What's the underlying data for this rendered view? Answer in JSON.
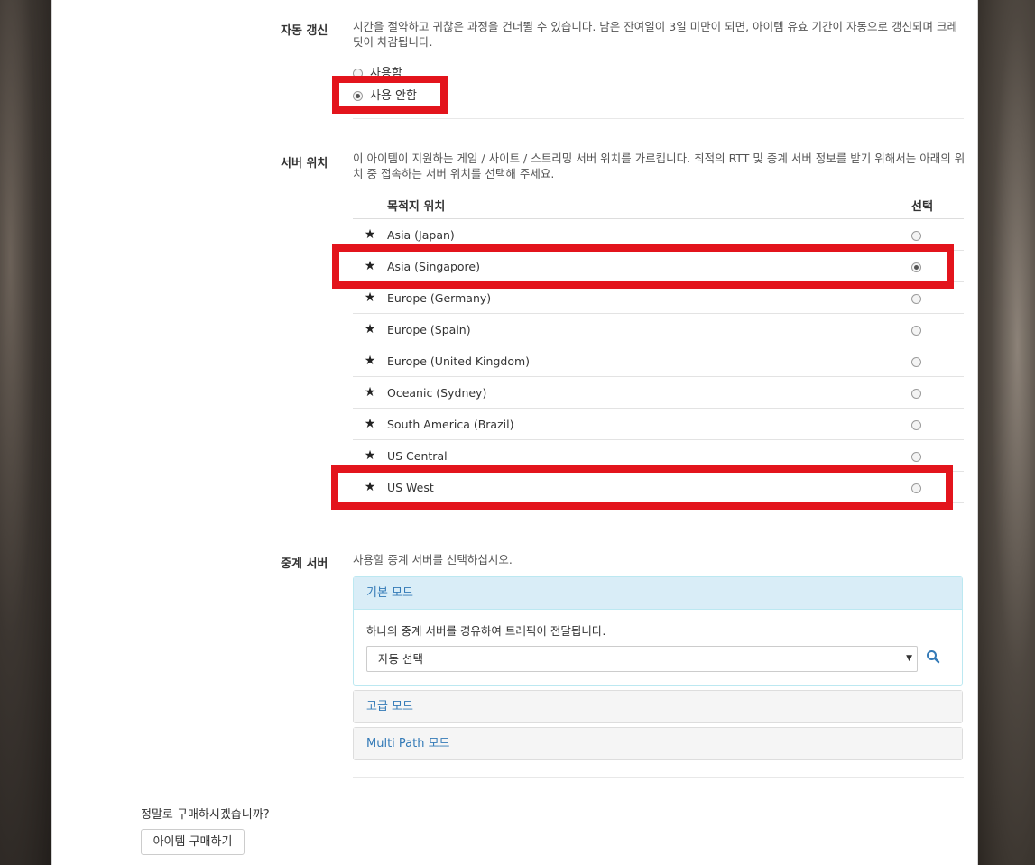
{
  "auto_renew": {
    "label": "자동 갱신",
    "description": "시간을 절약하고 귀찮은 과정을 건너뛸 수 있습니다. 남은 잔여일이 3일 미만이 되면, 아이템 유효 기간이 자동으로 갱신되며 크레딧이 차감됩니다.",
    "options": [
      {
        "label": "사용함",
        "checked": false
      },
      {
        "label": "사용 안함",
        "checked": true
      }
    ]
  },
  "server_location": {
    "label": "서버 위치",
    "description": "이 아이템이 지원하는 게임 / 사이트 / 스트리밍 서버 위치를 가르킵니다. 최적의 RTT 및 중계 서버 정보를 받기 위해서는 아래의 위치 중 접속하는 서버 위치를 선택해 주세요.",
    "col_destination": "목적지 위치",
    "col_select": "선택",
    "rows": [
      {
        "name": "Asia (Japan)",
        "selected": false
      },
      {
        "name": "Asia (Singapore)",
        "selected": true
      },
      {
        "name": "Europe (Germany)",
        "selected": false
      },
      {
        "name": "Europe (Spain)",
        "selected": false
      },
      {
        "name": "Europe (United Kingdom)",
        "selected": false
      },
      {
        "name": "Oceanic (Sydney)",
        "selected": false
      },
      {
        "name": "South America (Brazil)",
        "selected": false
      },
      {
        "name": "US Central",
        "selected": false
      },
      {
        "name": "US West",
        "selected": false
      }
    ]
  },
  "relay_server": {
    "label": "중계 서버",
    "description": "사용할 중계 서버를 선택하십시오.",
    "basic_mode": {
      "title": "기본 모드",
      "description": "하나의 중계 서버를 경유하여 트래픽이 전달됩니다.",
      "select_value": "자동 선택"
    },
    "advanced_mode_title": "고급 모드",
    "multipath_mode_title": "Multi Path 모드"
  },
  "purchase": {
    "question": "정말로 구매하시겠습니까?",
    "button_label": "아이템 구매하기"
  },
  "colors": {
    "highlight": "#e3141c",
    "link": "#337ab7",
    "active_panel": "#d9edf7"
  }
}
